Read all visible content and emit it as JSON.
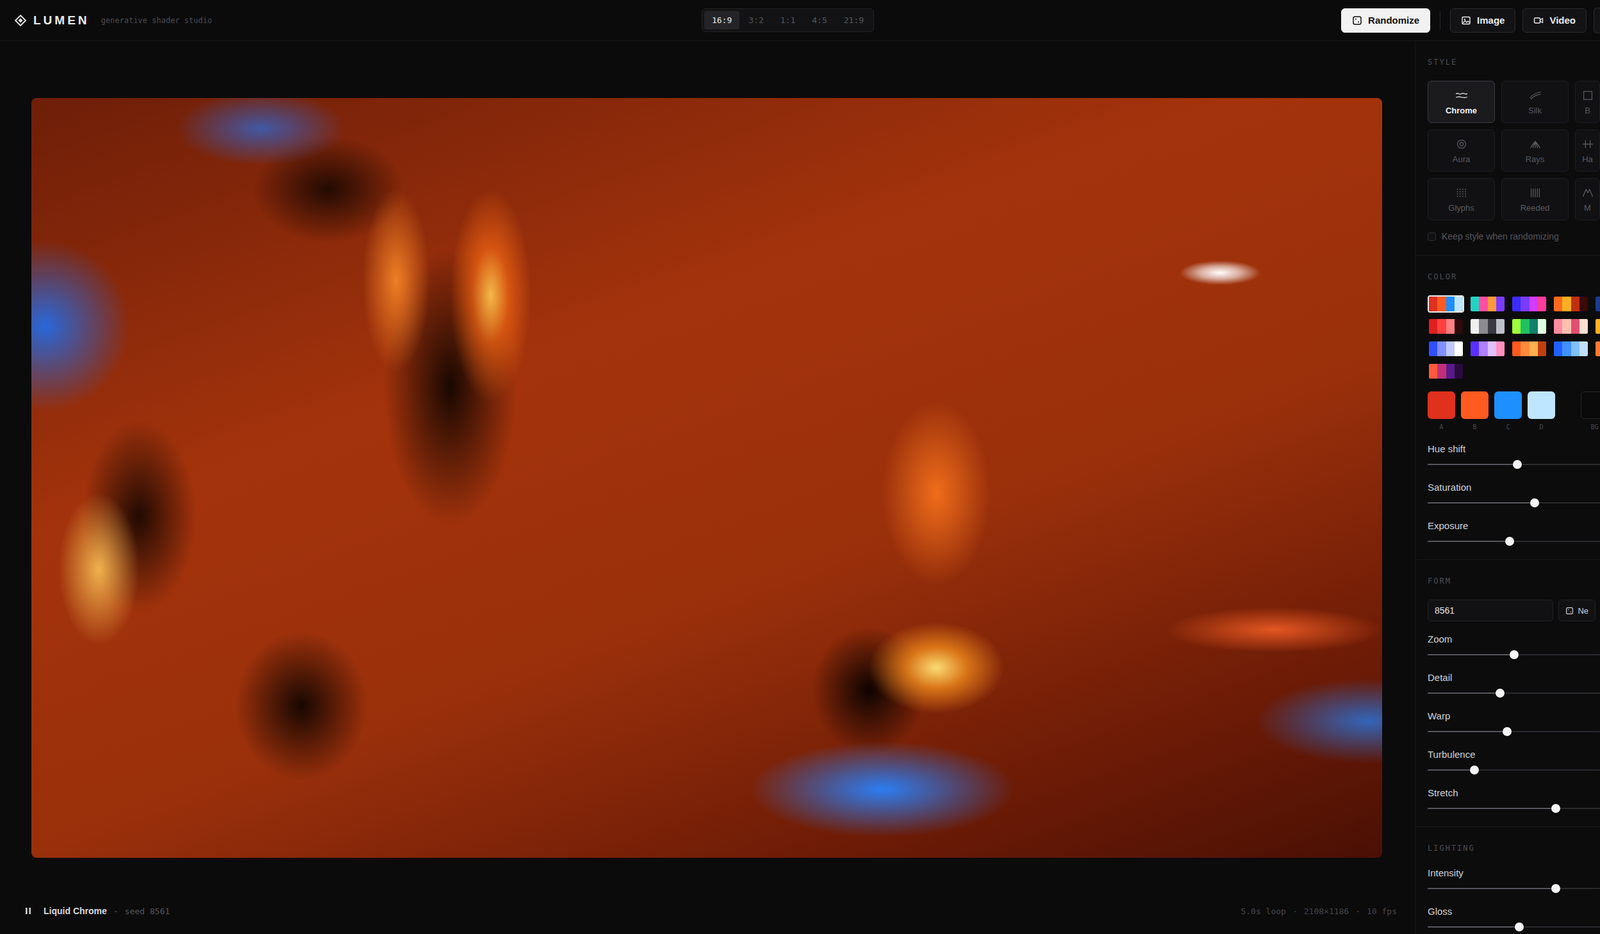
{
  "app": {
    "logo": "LUMEN",
    "tagline": "generative shader studio"
  },
  "aspect_ratios": [
    {
      "label": "16:9",
      "selected": true
    },
    {
      "label": "3:2",
      "selected": false
    },
    {
      "label": "1:1",
      "selected": false
    },
    {
      "label": "4:5",
      "selected": false
    },
    {
      "label": "21:9",
      "selected": false
    }
  ],
  "actions": [
    {
      "label": "Randomize",
      "primary": true
    },
    {
      "label": "Image",
      "primary": false
    },
    {
      "label": "Video",
      "primary": false
    }
  ],
  "style": {
    "title": "STYLE",
    "options": [
      {
        "label": "Chrome",
        "selected": true
      },
      {
        "label": "Silk",
        "selected": false
      },
      {
        "label": "B",
        "selected": false
      },
      {
        "label": "Aura",
        "selected": false
      },
      {
        "label": "Rays",
        "selected": false
      },
      {
        "label": "Ha",
        "selected": false
      },
      {
        "label": "Glyphs",
        "selected": false
      },
      {
        "label": "Reeded",
        "selected": false
      },
      {
        "label": "M",
        "selected": false
      }
    ],
    "keep_style": {
      "label": "Keep style when randomizing",
      "checked": false
    }
  },
  "color": {
    "title": "COLOR",
    "palettes": [
      {
        "colors": [
          "#e0301e",
          "#ff5a1f",
          "#1e8fff",
          "#bfe6ff"
        ],
        "selected": true
      },
      {
        "colors": [
          "#22d3c5",
          "#ff4fa3",
          "#ff9a3c",
          "#7b3cff"
        ],
        "selected": false
      },
      {
        "colors": [
          "#3b2cff",
          "#7a3cff",
          "#d23cff",
          "#ff3c9a"
        ],
        "selected": false
      },
      {
        "colors": [
          "#ff6a1f",
          "#ffb020",
          "#c0300f",
          "#3a0a05"
        ],
        "selected": false
      },
      {
        "colors": [
          "#1e3a8a",
          "#2f6bff",
          "#7fb0ff",
          "#d0e4ff"
        ],
        "selected": false
      },
      {
        "colors": [
          "#e0201e",
          "#ff4040",
          "#ff8080",
          "#2a0a0a"
        ],
        "selected": false
      },
      {
        "colors": [
          "#f0f0f0",
          "#8a8a90",
          "#3a3a40",
          "#c0c0c8"
        ],
        "selected": false
      },
      {
        "colors": [
          "#a0ff3c",
          "#20c060",
          "#10806a",
          "#e0ffe0"
        ],
        "selected": false
      },
      {
        "colors": [
          "#ff8aa0",
          "#ffc0b0",
          "#e05070",
          "#ffe0d0"
        ],
        "selected": false
      },
      {
        "colors": [
          "#ffb020",
          "#ff7a1f",
          "#c04010",
          "#ffe0a0"
        ],
        "selected": false
      },
      {
        "colors": [
          "#3050ff",
          "#8090ff",
          "#c0c8ff",
          "#ffffff"
        ],
        "selected": false
      },
      {
        "colors": [
          "#5a30ff",
          "#b080ff",
          "#e0c0ff",
          "#ff90c0"
        ],
        "selected": false
      },
      {
        "colors": [
          "#ff5a1f",
          "#ff8a3c",
          "#ffb050",
          "#c04010"
        ],
        "selected": false
      },
      {
        "colors": [
          "#2060ff",
          "#4090ff",
          "#80c0ff",
          "#c0e0ff"
        ],
        "selected": false
      },
      {
        "colors": [
          "#ff7a30",
          "#ffa050",
          "#ffc080",
          "#c05020"
        ],
        "selected": false
      },
      {
        "colors": [
          "#ff5a3c",
          "#c0307a",
          "#5a1a8a",
          "#2a0a40"
        ],
        "selected": false
      }
    ],
    "swatches": [
      {
        "label": "A",
        "color": "#e0301e"
      },
      {
        "label": "B",
        "color": "#ff5a1f"
      },
      {
        "label": "C",
        "color": "#1e8fff"
      },
      {
        "label": "D",
        "color": "#bfe6ff"
      }
    ],
    "background": {
      "label": "BG",
      "color": "#0a0a0b"
    },
    "sliders": [
      {
        "label": "Hue shift",
        "level": 0.52
      },
      {
        "label": "Saturation",
        "level": 0.62
      },
      {
        "label": "Exposure",
        "level": 0.475
      }
    ]
  },
  "form": {
    "title": "FORM",
    "seed": "8561",
    "new_button": "Ne",
    "sliders": [
      {
        "label": "Zoom",
        "level": 0.5
      },
      {
        "label": "Detail",
        "level": 0.42
      },
      {
        "label": "Warp",
        "level": 0.46
      },
      {
        "label": "Turbulence",
        "level": 0.27
      },
      {
        "label": "Stretch",
        "level": 0.745
      }
    ]
  },
  "lighting": {
    "title": "LIGHTING",
    "sliders": [
      {
        "label": "Intensity",
        "level": 0.745
      },
      {
        "label": "Gloss",
        "level": 0.53
      }
    ]
  },
  "footer": {
    "name": "Liquid Chrome",
    "seed": "seed 8561",
    "separator": "·",
    "stats": [
      "5.0s loop",
      "2108×1186",
      "10 fps"
    ]
  }
}
